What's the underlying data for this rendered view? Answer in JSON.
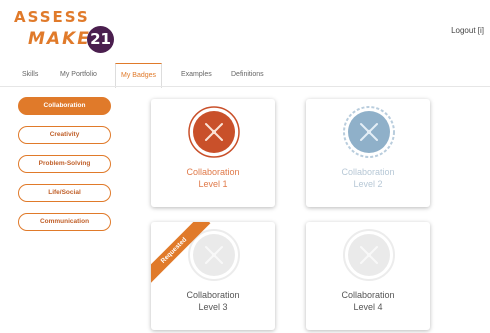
{
  "header": {
    "logo_line1": "ASSESS",
    "logo_line2": "MAKE",
    "logo_badge": "21",
    "logout": "Logout [i]"
  },
  "tabs": [
    {
      "label": "Skills"
    },
    {
      "label": "My Portfolio"
    },
    {
      "label": "My Badges",
      "active": true
    },
    {
      "label": "Examples"
    },
    {
      "label": "Definitions"
    }
  ],
  "sidebar": {
    "items": [
      {
        "label": "Collaboration",
        "active": true
      },
      {
        "label": "Creativity"
      },
      {
        "label": "Problem-Solving"
      },
      {
        "label": "Life/Social"
      },
      {
        "label": "Communication"
      }
    ]
  },
  "badges": [
    {
      "title": "Collaboration",
      "level": "Level 1",
      "state": "earned",
      "color": "#c9502a"
    },
    {
      "title": "Collaboration",
      "level": "Level 2",
      "state": "available",
      "color": "#8fb0c9"
    },
    {
      "title": "Collaboration",
      "level": "Level 3",
      "state": "locked",
      "ribbon": "Requested",
      "color": "#e0e0e0"
    },
    {
      "title": "Collaboration",
      "level": "Level 4",
      "state": "locked",
      "color": "#e0e0e0"
    }
  ],
  "colors": {
    "accent": "#e07a2a",
    "logo_badge": "#4a1e4e"
  }
}
